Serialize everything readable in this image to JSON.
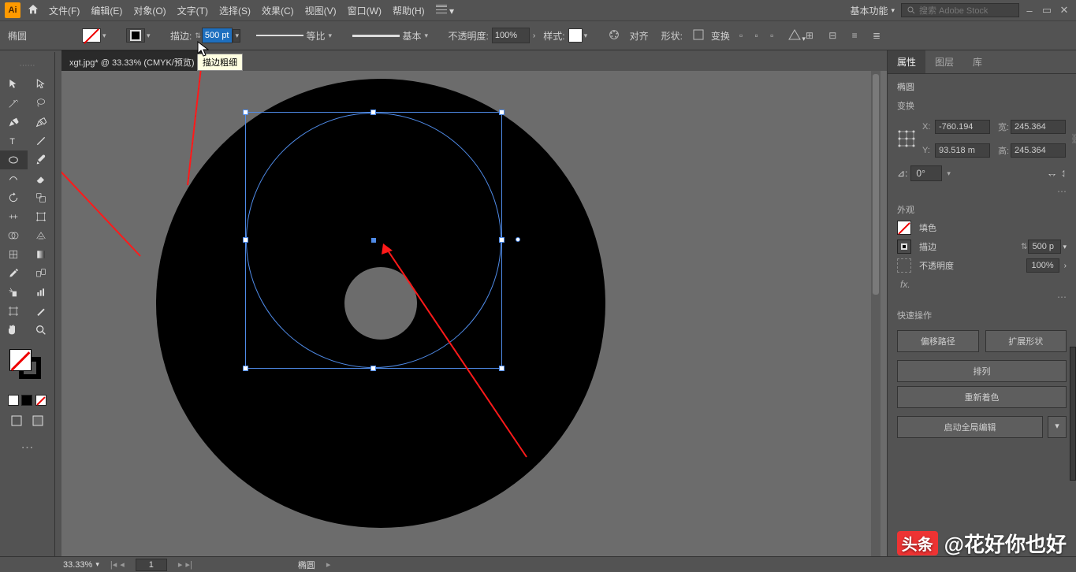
{
  "app": {
    "abbr": "Ai"
  },
  "menubar": {
    "items": [
      "文件(F)",
      "编辑(E)",
      "对象(O)",
      "文字(T)",
      "选择(S)",
      "效果(C)",
      "视图(V)",
      "窗口(W)",
      "帮助(H)"
    ],
    "workspace": "基本功能",
    "search_placeholder": "搜索 Adobe Stock"
  },
  "controlbar": {
    "shape": "椭圆",
    "stroke_label": "描边:",
    "stroke_value": "500 pt",
    "profile1": "等比",
    "profile2": "基本",
    "opacity_label": "不透明度:",
    "opacity_value": "100%",
    "style_label": "样式:",
    "align_label": "对齐",
    "shape_label": "形状:",
    "transform_label": "变换"
  },
  "doc": {
    "title": "xgt.jpg* @ 33.33% (CMYK/预览)"
  },
  "tooltip": "描边粗细",
  "panel": {
    "tabs": [
      "属性",
      "图层",
      "库"
    ],
    "object": "椭圆",
    "sect_transform": "变换",
    "x_label": "X:",
    "x": "-760.194",
    "y_label": "Y:",
    "y": "93.518 m",
    "w_label": "宽:",
    "w": "245.364",
    "h_label": "高:",
    "h": "245.364",
    "rot_label": "⊿:",
    "rot": "0°",
    "sect_appearance": "外观",
    "fill_label": "填色",
    "stroke_label": "描边",
    "stroke_val": "500 p",
    "opac_label": "不透明度",
    "opac_val": "100%",
    "fx": "fx.",
    "sect_quick": "快速操作",
    "btn_offset": "偏移路径",
    "btn_expand": "扩展形状",
    "btn_arrange": "排列",
    "btn_recolor": "重新着色",
    "btn_global": "启动全局编辑"
  },
  "status": {
    "zoom": "33.33%",
    "page": "1",
    "sel": "椭圆"
  },
  "watermark": {
    "logo": "头条",
    "text": "@花好你也好"
  }
}
